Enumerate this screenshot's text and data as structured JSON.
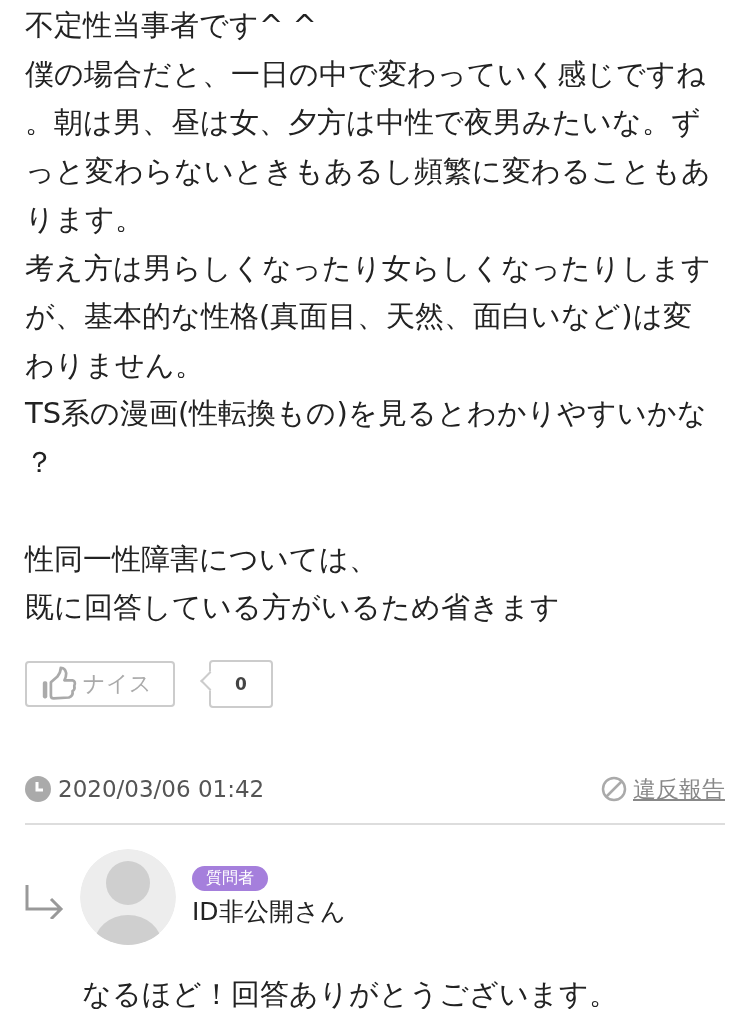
{
  "answer": {
    "blocks": [
      [
        "不定性当事者です^ ^",
        "僕の場合だと、一日の中で変わっていく感じですね。朝は男、昼は女、夕方は中性で夜男みたいな。ずっと変わらないときもあるし頻繁に変わることもあります。",
        "考え方は男らしくなったり女らしくなったりしますが、基本的な性格(真面目、天然、面白いなど)は変わりません。",
        "TS系の漫画(性転換もの)を見るとわかりやすいかな？"
      ],
      [
        "性同一性障害については、",
        "既に回答している方がいるため省きます"
      ]
    ],
    "nice_button": {
      "label": "ナイス",
      "selected": false
    },
    "nice_count": "0",
    "timestamp": "2020/03/06 01:42",
    "report_link": "違反報告"
  },
  "reply": {
    "badge": "質問者",
    "author": "ID非公開さん",
    "body": "なるほど！回答ありがとうございます。"
  }
}
